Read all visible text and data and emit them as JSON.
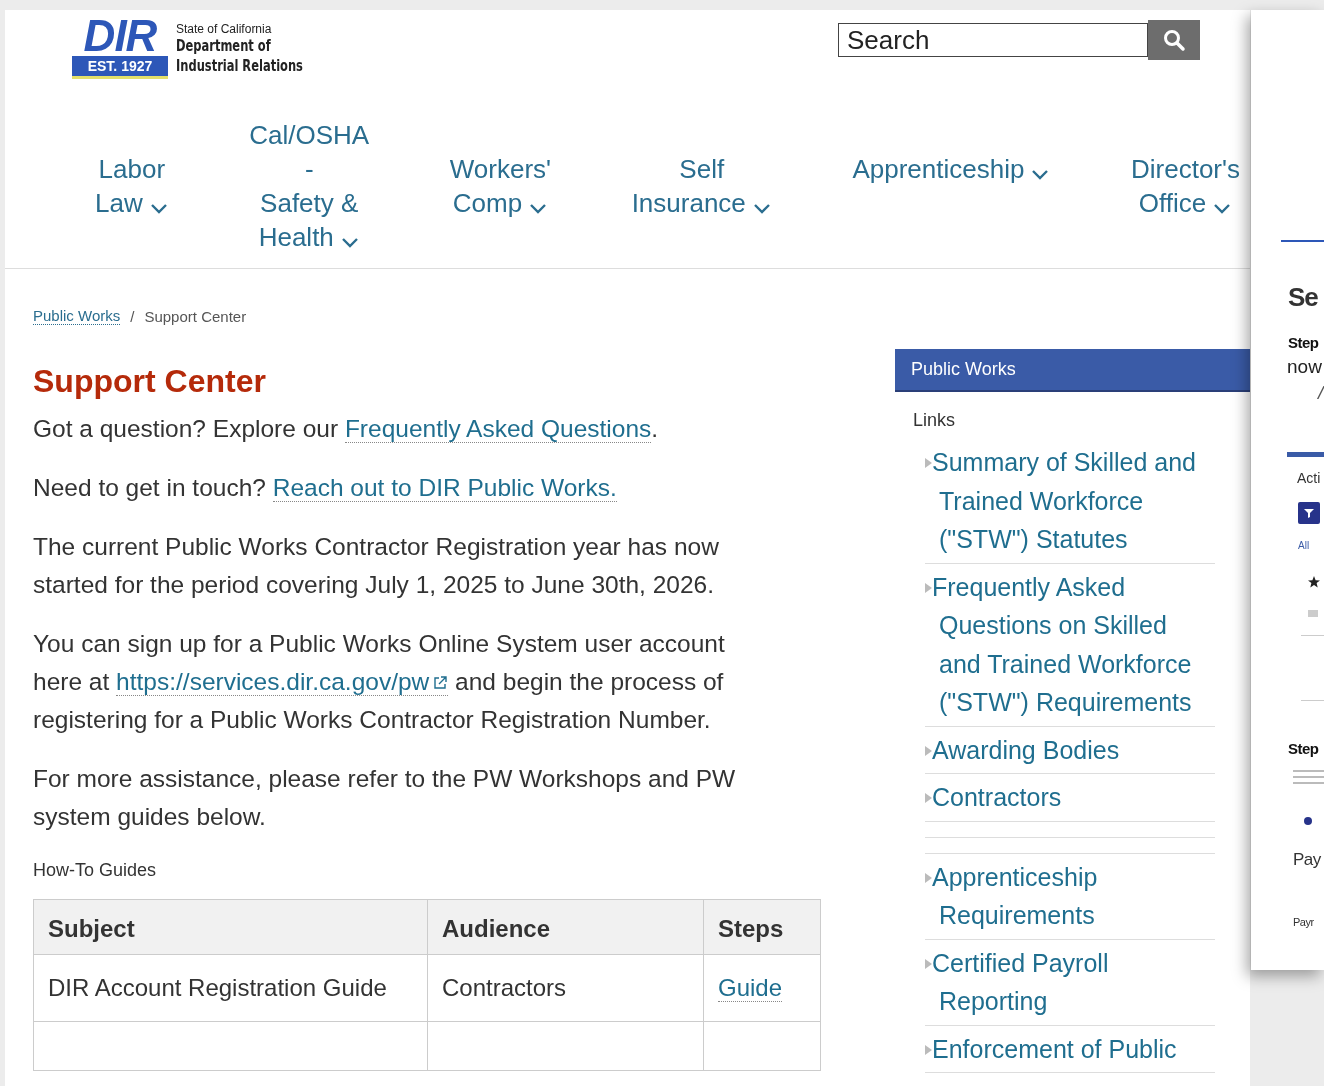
{
  "logo": {
    "mark": "DIR",
    "est": "EST. 1927",
    "state": "State of California",
    "dept_line1": "Department of",
    "dept_line2": "Industrial Relations"
  },
  "search": {
    "placeholder": "Search"
  },
  "nav": [
    {
      "lines": [
        "Labor",
        "Law"
      ]
    },
    {
      "lines": [
        "Cal/OSHA",
        "-",
        "Safety &",
        "Health"
      ]
    },
    {
      "lines": [
        "Workers'",
        "Comp"
      ]
    },
    {
      "lines": [
        "Self",
        "Insurance"
      ]
    },
    {
      "lines": [
        "Apprenticeship"
      ]
    },
    {
      "lines": [
        "Director's",
        "Office"
      ]
    }
  ],
  "breadcrumb": [
    {
      "label": "Public Works",
      "kind": "link"
    },
    {
      "label": "/",
      "kind": "separator"
    },
    {
      "label": "Support Center",
      "kind": "current"
    }
  ],
  "title": "Support Center",
  "paragraphs": [
    [
      {
        "text": "Got a question? Explore our ",
        "kind": "text"
      },
      {
        "text": "Frequently Asked Questions",
        "kind": "link"
      },
      {
        "text": ".",
        "kind": "text"
      }
    ],
    [
      {
        "text": "Need to get in touch? ",
        "kind": "text"
      },
      {
        "text": "Reach out to DIR Public Works.",
        "kind": "link"
      }
    ],
    [
      {
        "text": "The current Public Works Contractor Registration year has now started for the period covering July 1, 2025 to June 30th, 2026.",
        "kind": "text"
      }
    ],
    [
      {
        "text": "You can sign up for a Public Works Online System user account here at ",
        "kind": "text"
      },
      {
        "text": "https://services.dir.ca.gov/pw",
        "kind": "external"
      },
      {
        "text": " and begin the process of registering for a Public Works Contractor Registration Number.",
        "kind": "text"
      }
    ],
    [
      {
        "text": "For more assistance, please refer to the PW Workshops and PW system guides below.",
        "kind": "text"
      }
    ]
  ],
  "guides": {
    "heading": "How-To Guides",
    "columns": [
      "Subject",
      "Audience",
      "Steps"
    ],
    "rows": [
      {
        "subject": "DIR Account Registration Guide",
        "audience": "Contractors",
        "steps": "Guide"
      }
    ]
  },
  "sidebar": {
    "title": "Public Works",
    "subtitle": "Links",
    "items": [
      {
        "kind": "link",
        "label": "Summary of Skilled and Trained Workforce (\"STW\") Statutes"
      },
      {
        "kind": "link",
        "label": "Frequently Asked Questions on Skilled and Trained Workforce (\"STW\") Requirements"
      },
      {
        "kind": "link",
        "label": "Awarding Bodies"
      },
      {
        "kind": "link",
        "label": "Contractors"
      },
      {
        "kind": "spacer"
      },
      {
        "kind": "spacer"
      },
      {
        "kind": "link",
        "label": "Apprenticeship Requirements"
      },
      {
        "kind": "link",
        "label": "Certified Payroll Reporting"
      },
      {
        "kind": "link",
        "label": "Enforcement of Public"
      }
    ]
  },
  "overlay_window": {
    "heading": "Se",
    "step1": "Step",
    "line1": "now",
    "line2": "/",
    "tab": "Acti",
    "filter": "All",
    "step2": "Step",
    "row1": "Pay",
    "row2": "Payr"
  }
}
